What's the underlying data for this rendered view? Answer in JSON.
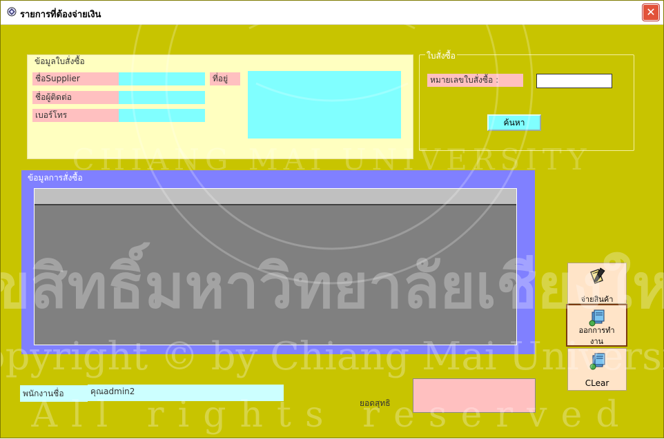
{
  "window": {
    "title": "รายการที่ต้องจ่ายเงิน",
    "close_symbol": "✕"
  },
  "supplier_info": {
    "group_label": "ข้อมูลใบสั่งซื้อ",
    "supplier_name_label": "ชื่อSupplier",
    "contact_name_label": "ชื่อผู้ติดต่อ",
    "phone_label": "เบอร์โทร",
    "address_label": "ที่อยู่"
  },
  "purchase_order": {
    "group_label": "ใบสั่งซื้อ",
    "po_number_label": "หมายเลขใบสั่งซื้อ :",
    "po_number_value": "",
    "search_button": "ค้นหา"
  },
  "order_details": {
    "group_label": "ข้อมูลการสั่งซื้อ"
  },
  "actions": {
    "pay_label": "จ่ายสินค้า",
    "exit_label_1": "ออกการทำ",
    "exit_label_2": "งาน",
    "clear_label": "CLear"
  },
  "footer": {
    "employee_label": "พนักงานชื่อ",
    "employee_value": "คุณadmin2",
    "total_label": "ยอดสุทธิ",
    "total_value": ""
  },
  "watermark": {
    "line1": "ลิขสิทธิ์มหาวิทยาลัยเชียงใหม่",
    "line2": "Copyright © by Chiang Mai University",
    "line3": "All rights reserved",
    "seal_text": "CHIANG MAI UNIVERSITY"
  },
  "colors": {
    "background": "#c8c400",
    "panel": "#ffffc0",
    "label_pink": "#ffc0c0",
    "field_cyan": "#80ffff",
    "grid_border": "#8080ff",
    "grid": "#808080"
  }
}
